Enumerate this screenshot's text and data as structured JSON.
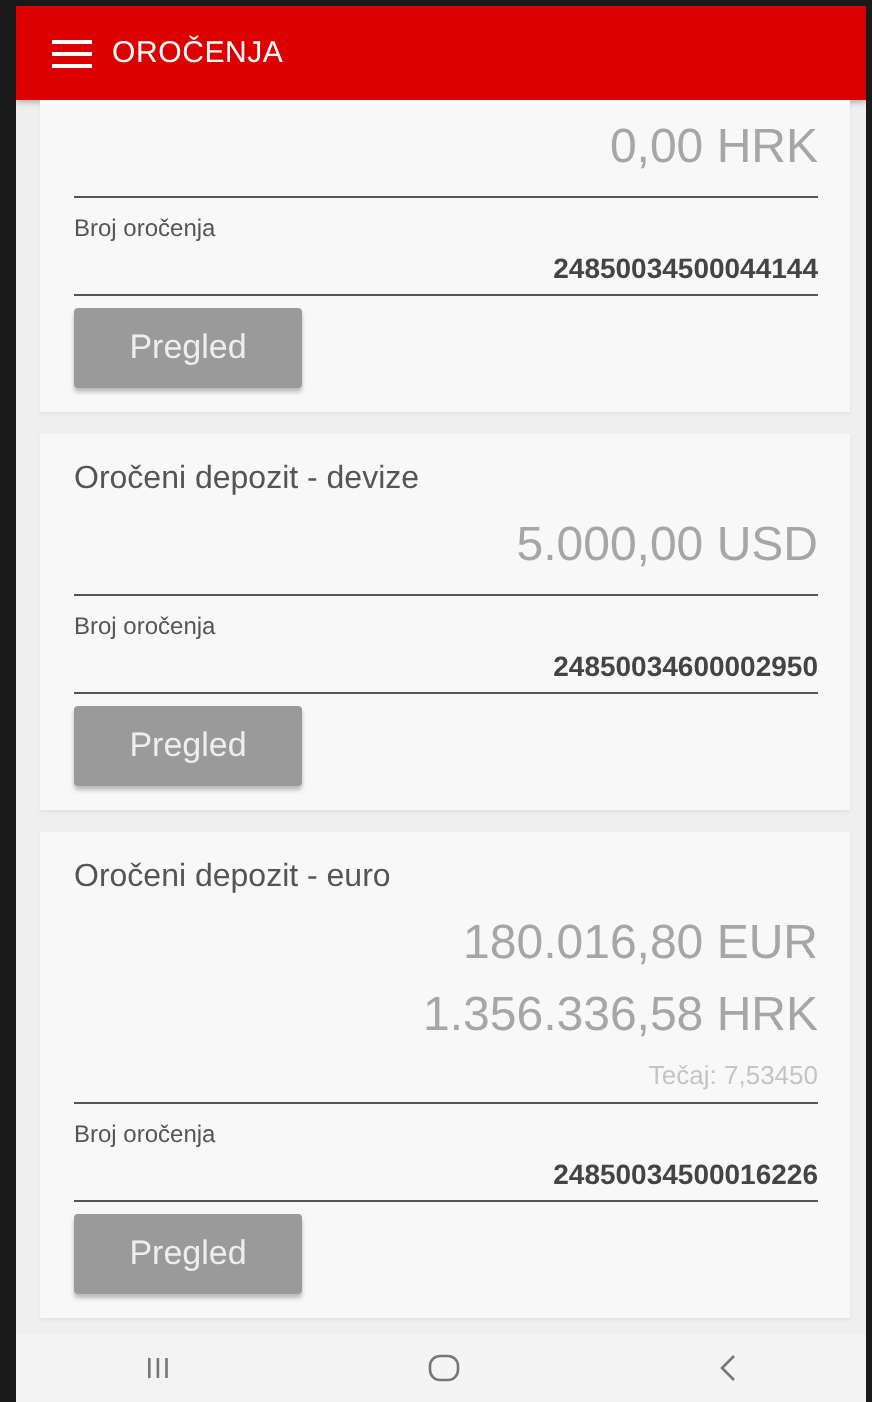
{
  "header": {
    "title": "OROČENJA"
  },
  "deposits": [
    {
      "amounts": [
        "0,00 HRK"
      ],
      "number_label": "Broj oročenja",
      "number": "24850034500044144",
      "button": "Pregled"
    },
    {
      "title": "Oročeni depozit - devize",
      "amounts": [
        "5.000,00 USD"
      ],
      "number_label": "Broj oročenja",
      "number": "24850034600002950",
      "button": "Pregled"
    },
    {
      "title": "Oročeni depozit - euro",
      "amounts": [
        "180.016,80 EUR",
        "1.356.336,58 HRK"
      ],
      "rate": "Tečaj: 7,53450",
      "number_label": "Broj oročenja",
      "number": "24850034500016226",
      "button": "Pregled"
    }
  ]
}
